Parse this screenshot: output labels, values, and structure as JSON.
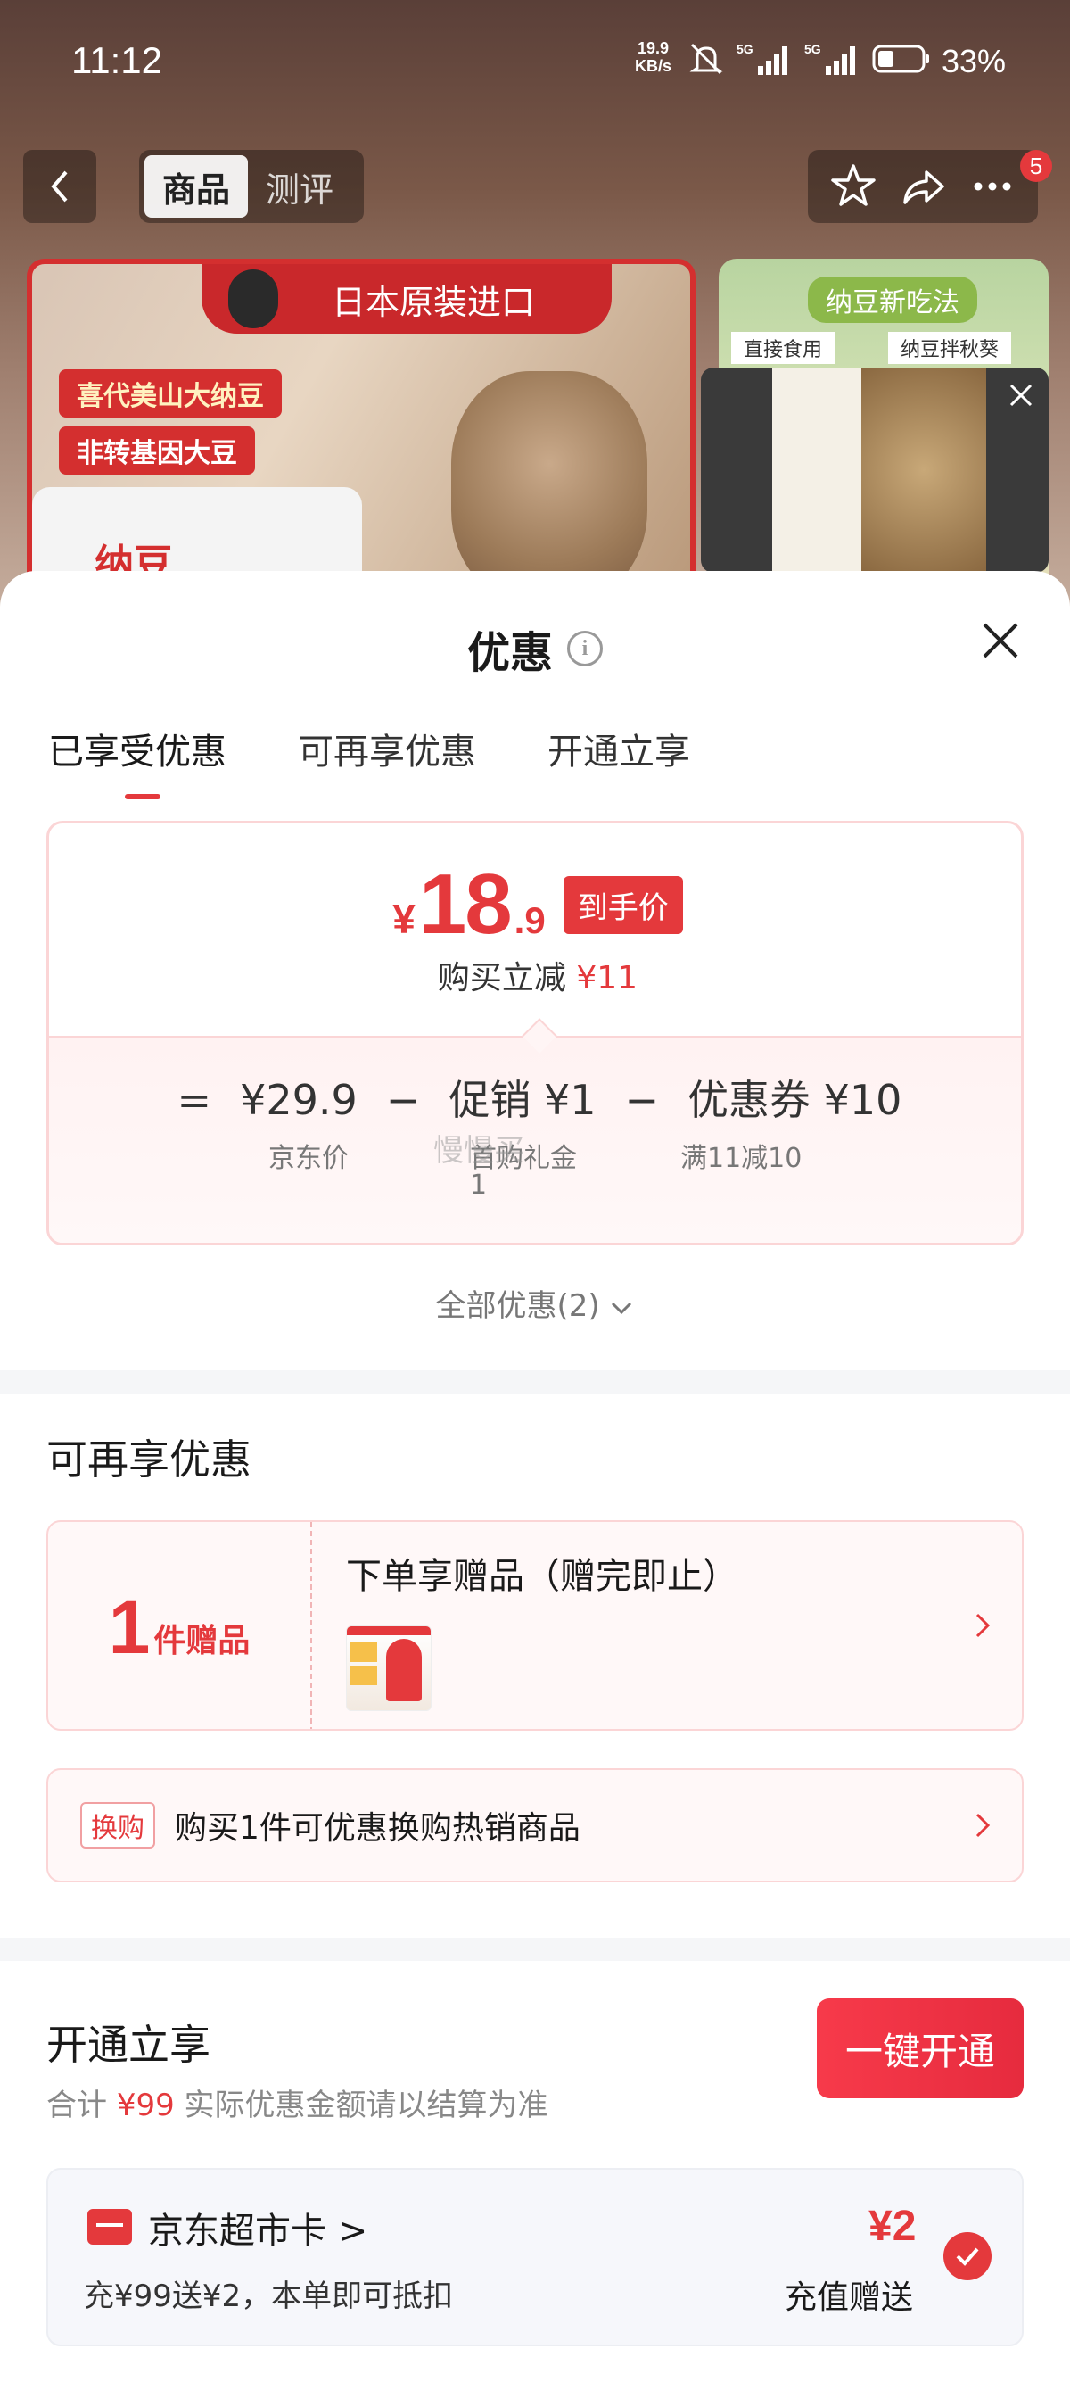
{
  "status_bar": {
    "time": "11:12",
    "net_speed_value": "19.9",
    "net_speed_unit": "KB/s",
    "battery": "33%"
  },
  "nav": {
    "tabs": [
      "商品",
      "测评"
    ],
    "active_tab": 0,
    "badge_count": "5"
  },
  "product_image": {
    "banner": "日本原装进口",
    "tag1": "喜代美山大纳豆",
    "tag2": "非转基因大豆",
    "box_text": "纳豆",
    "side_title": "纳豆新吃法",
    "side_label1": "直接食用",
    "side_label2": "纳豆拌秋葵"
  },
  "sheet": {
    "title": "优惠",
    "tabs": [
      "已享受优惠",
      "可再享优惠",
      "开通立享"
    ],
    "active_tab": 0
  },
  "price_card": {
    "yen": "¥",
    "price_int": "18",
    "price_dec": ".9",
    "price_tag": "到手价",
    "reduce_label": "购买立减",
    "reduce_amount": "¥11",
    "eq": "=",
    "jd_price": "¥29.9",
    "jd_price_label": "京东价",
    "minus1": "−",
    "promo": "促销 ¥1",
    "promo_label": "首购礼金",
    "promo_label2": "1",
    "minus2": "−",
    "coupon": "优惠券 ¥10",
    "coupon_label": "满11减10"
  },
  "all_offers": "全部优惠(2)",
  "more_offers": {
    "title": "可再享优惠",
    "gift_num": "1",
    "gift_unit": "件赠品",
    "gift_title": "下单享赠品（赠完即止）",
    "swap_tag": "换购",
    "swap_text": "购买1件可优惠换购热销商品"
  },
  "open": {
    "title": "开通立享",
    "sub_prefix": "合计",
    "sub_amount": "¥99",
    "sub_suffix": "实际优惠金额请以结算为准",
    "button": "一键开通",
    "card_name": "京东超市卡 >",
    "card_desc": "充¥99送¥2，本单即可抵扣",
    "card_amount": "¥2",
    "card_amount_label": "充值赠送"
  },
  "watermark": "慢慢买",
  "colors": {
    "accent": "#e4393c",
    "card_border": "#fbd5d6",
    "band": "#f5f6f8"
  }
}
